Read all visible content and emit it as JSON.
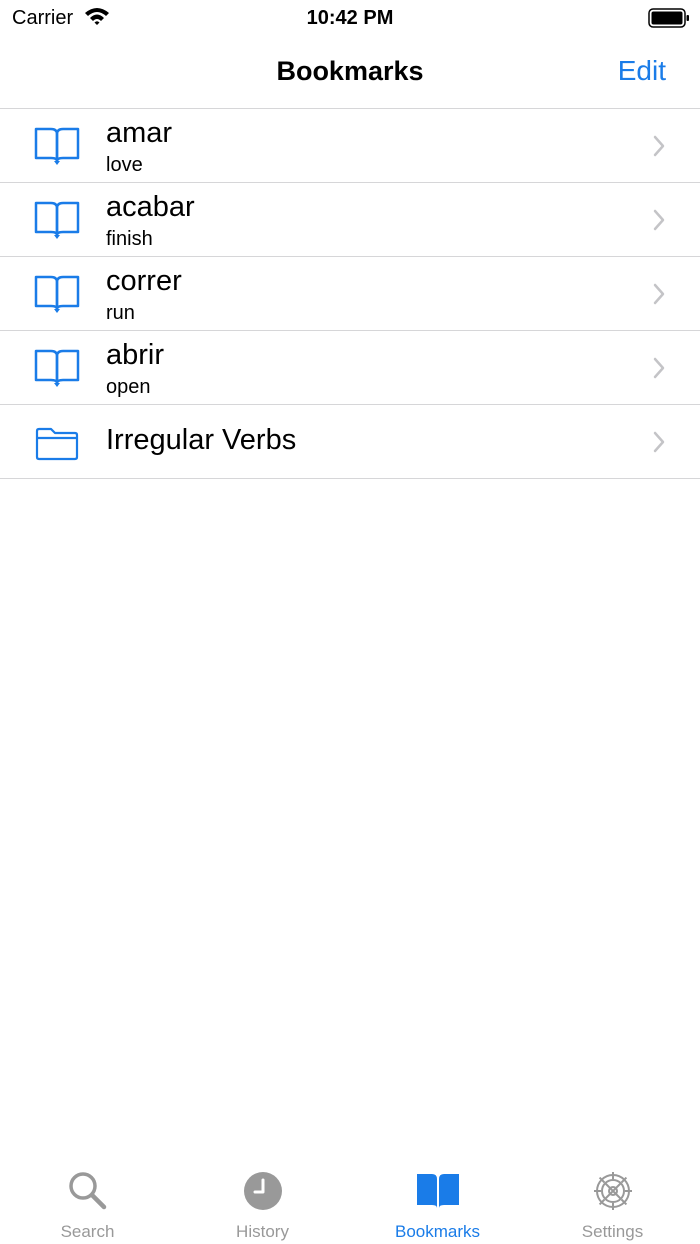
{
  "status_bar": {
    "carrier": "Carrier",
    "time": "10:42 PM"
  },
  "nav": {
    "title": "Bookmarks",
    "edit_label": "Edit"
  },
  "bookmarks": [
    {
      "word": "amar",
      "translation": "love"
    },
    {
      "word": "acabar",
      "translation": "finish"
    },
    {
      "word": "correr",
      "translation": "run"
    },
    {
      "word": "abrir",
      "translation": "open"
    }
  ],
  "folder": {
    "label": "Irregular Verbs"
  },
  "tabs": [
    {
      "label": "Search",
      "icon": "magnifier-icon"
    },
    {
      "label": "History",
      "icon": "clock-icon"
    },
    {
      "label": "Bookmarks",
      "icon": "book-icon",
      "active": true
    },
    {
      "label": "Settings",
      "icon": "gear-icon"
    }
  ],
  "colors": {
    "accent": "#1a7ce8",
    "inactive": "#999999",
    "separator": "#d6d6d8"
  }
}
